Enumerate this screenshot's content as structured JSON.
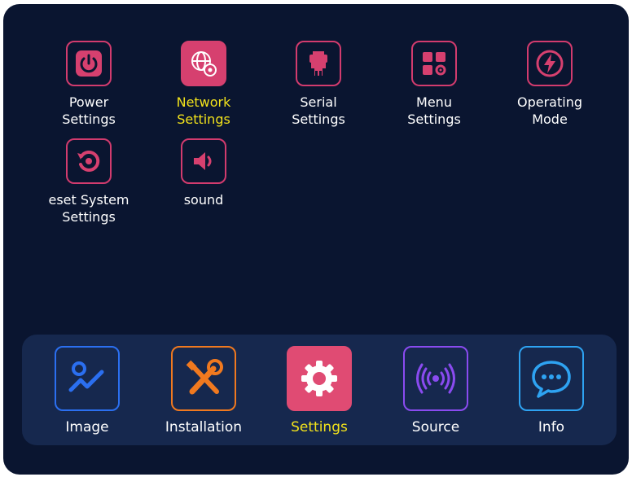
{
  "grid": [
    {
      "label": "Power\nSettings",
      "icon": "power-icon"
    },
    {
      "label": "Network\nSettings",
      "icon": "network-settings-icon",
      "active": true
    },
    {
      "label": "Serial\nSettings",
      "icon": "serial-port-icon"
    },
    {
      "label": "Menu\nSettings",
      "icon": "menu-settings-icon"
    },
    {
      "label": "Operating\nMode",
      "icon": "lightning-icon"
    },
    {
      "label": "eset System\nSettings",
      "icon": "reset-icon"
    },
    {
      "label": "sound",
      "icon": "speaker-icon"
    }
  ],
  "dock": [
    {
      "label": "Image",
      "icon": "image-chart-icon",
      "color": "#2b6ff0"
    },
    {
      "label": "Installation",
      "icon": "tools-icon",
      "color": "#f0791f"
    },
    {
      "label": "Settings",
      "icon": "gear-icon",
      "color": "#e04b73",
      "active": true
    },
    {
      "label": "Source",
      "icon": "broadcast-icon",
      "color": "#8a4bf0"
    },
    {
      "label": "Info",
      "icon": "chat-bubble-icon",
      "color": "#2ea3f2"
    }
  ],
  "colors": {
    "background": "#0a1530",
    "dock_background": "#16284e",
    "accent": "#d6406f",
    "active_text": "#f2e21b"
  }
}
